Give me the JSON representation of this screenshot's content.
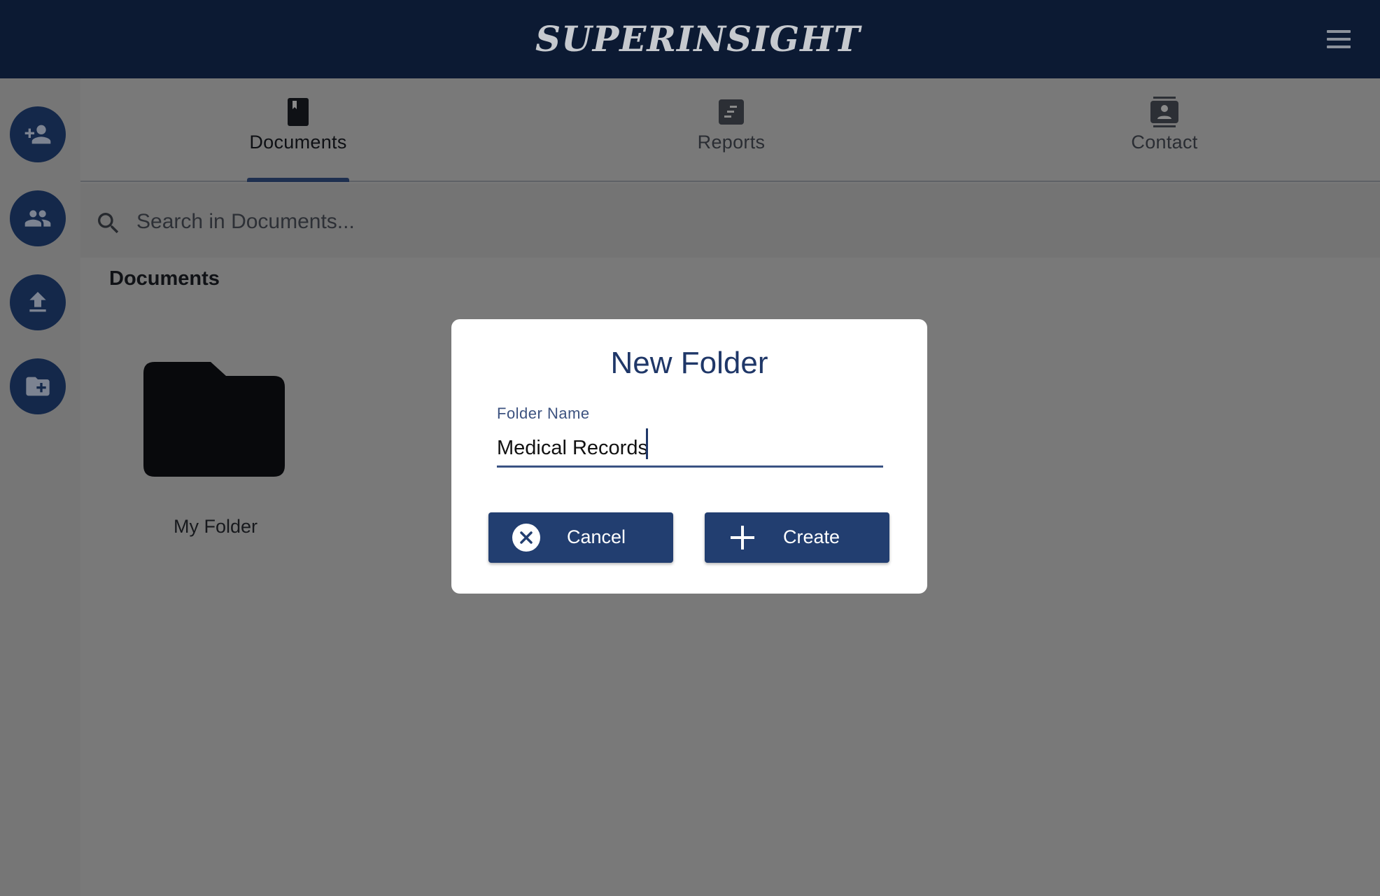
{
  "header": {
    "brand": "SUPERINSIGHT",
    "menu_icon": "hamburger-menu-icon"
  },
  "rail": {
    "buttons": [
      {
        "icon": "add-user-icon"
      },
      {
        "icon": "group-icon"
      },
      {
        "icon": "upload-icon"
      },
      {
        "icon": "new-folder-icon"
      }
    ]
  },
  "tabs": [
    {
      "label": "Documents",
      "icon": "book-icon",
      "active": true
    },
    {
      "label": "Reports",
      "icon": "report-icon",
      "active": false
    },
    {
      "label": "Contact",
      "icon": "contact-card-icon",
      "active": false
    }
  ],
  "search": {
    "placeholder": "Search in Documents..."
  },
  "content": {
    "section_title": "Documents",
    "folders": [
      {
        "name": "My Folder"
      }
    ]
  },
  "dialog": {
    "title": "New Folder",
    "field_label": "Folder Name",
    "field_value": "Medical Records",
    "cancel_label": "Cancel",
    "create_label": "Create"
  },
  "colors": {
    "header_bg": "#0c1a33",
    "accent": "#223e70",
    "overlay_bg": "#797979"
  }
}
